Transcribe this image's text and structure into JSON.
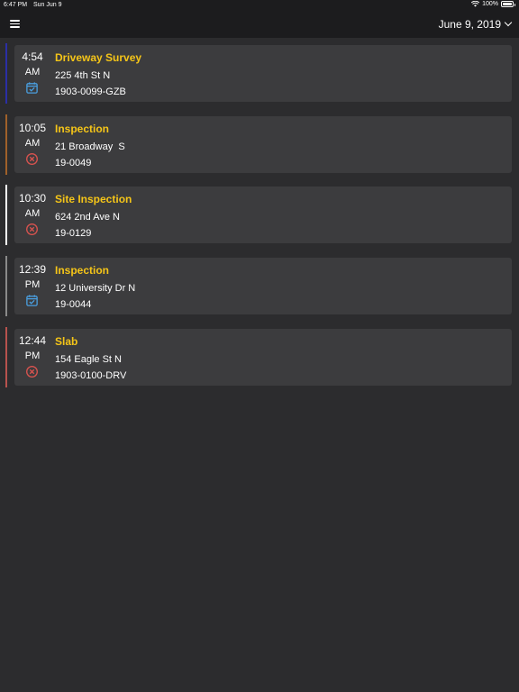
{
  "status_bar": {
    "time": "6:47 PM",
    "date": "Sun Jun 9",
    "battery": "100%"
  },
  "header": {
    "menu_icon": "hamburger-menu-icon",
    "date": "June 9, 2019"
  },
  "colors": {
    "background": "#2c2c2e",
    "bar": "#1c1c1e",
    "card": "#3c3c3e",
    "title": "#f5c518",
    "scheduled_icon": "#4a9fe0",
    "cancelled_icon": "#d9534f"
  },
  "appointments": [
    {
      "time": "4:54",
      "ampm": "AM",
      "title": "Driveway Survey",
      "address": "225 4th St N",
      "number": "1903-0099-GZB",
      "status_icon": "calendar-check-icon",
      "accent": "#2b2fa6"
    },
    {
      "time": "10:05",
      "ampm": "AM",
      "title": "Inspection",
      "address": "21 Broadway  S",
      "number": "19-0049",
      "status_icon": "cancel-circle-icon",
      "accent": "#a0612a"
    },
    {
      "time": "10:30",
      "ampm": "AM",
      "title": "Site Inspection",
      "address": "624 2nd Ave N",
      "number": "19-0129",
      "status_icon": "cancel-circle-icon",
      "accent": "#ffffff"
    },
    {
      "time": "12:39",
      "ampm": "PM",
      "title": "Inspection",
      "address": "12 University Dr N",
      "number": "19-0044",
      "status_icon": "calendar-check-icon",
      "accent": "#8a8a8a"
    },
    {
      "time": "12:44",
      "ampm": "PM",
      "title": "Slab",
      "address": "154 Eagle St N",
      "number": "1903-0100-DRV",
      "status_icon": "cancel-circle-icon",
      "accent": "#b8524e"
    }
  ]
}
